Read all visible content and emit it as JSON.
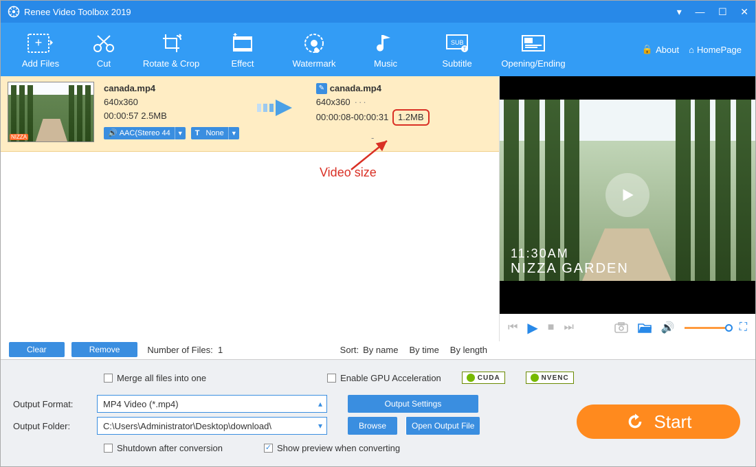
{
  "window": {
    "title": "Renee Video Toolbox 2019"
  },
  "toolbar": {
    "items": [
      {
        "label": "Add Files"
      },
      {
        "label": "Cut"
      },
      {
        "label": "Rotate & Crop"
      },
      {
        "label": "Effect"
      },
      {
        "label": "Watermark"
      },
      {
        "label": "Music"
      },
      {
        "label": "Subtitle"
      },
      {
        "label": "Opening/Ending"
      }
    ],
    "about": "About",
    "homepage": "HomePage"
  },
  "file": {
    "in": {
      "name": "canada.mp4",
      "res": "640x360",
      "dur": "00:00:57",
      "size": "2.5MB",
      "audio_tag": "AAC(Stereo 44",
      "text_tag": "None"
    },
    "out": {
      "name": "canada.mp4",
      "res": "640x360",
      "range": "00:00:08-00:00:31",
      "size": "1.2MB",
      "dash": "-"
    },
    "thumb_badge": "NIZZA"
  },
  "annotation": {
    "label": "Video size"
  },
  "preview": {
    "overlay_time": "11:30AM",
    "overlay_text": "NIZZA GARDEN"
  },
  "actions": {
    "clear": "Clear",
    "remove": "Remove",
    "count_label": "Number of Files:",
    "count": "1",
    "sort_label": "Sort:",
    "by_name": "By name",
    "by_time": "By time",
    "by_length": "By length"
  },
  "bottom": {
    "merge": "Merge all files into one",
    "gpu": "Enable GPU Acceleration",
    "badge_cuda": "CUDA",
    "badge_nvenc": "NVENC",
    "format_label": "Output Format:",
    "format_value": "MP4 Video (*.mp4)",
    "output_settings": "Output Settings",
    "folder_label": "Output Folder:",
    "folder_value": "C:\\Users\\Administrator\\Desktop\\download\\",
    "browse": "Browse",
    "open_output": "Open Output File",
    "shutdown": "Shutdown after conversion",
    "show_preview": "Show preview when converting",
    "start": "Start"
  }
}
